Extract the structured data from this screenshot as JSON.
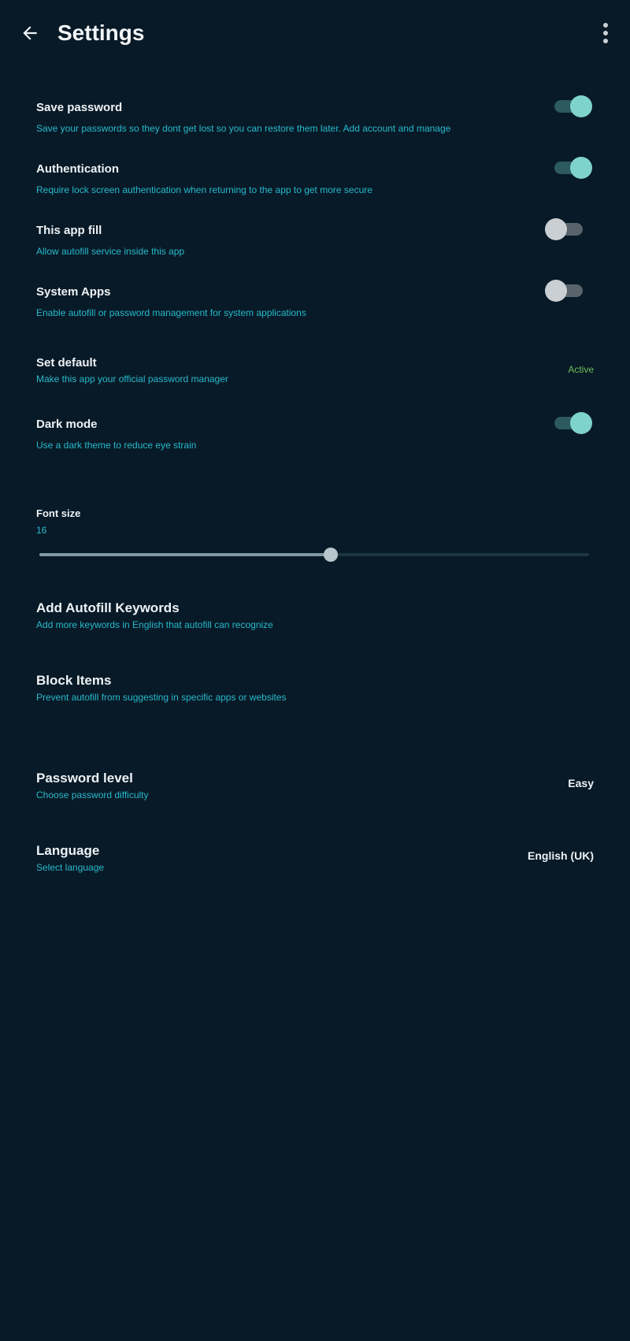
{
  "appbar": {
    "title": "Settings",
    "back_icon": "arrow-back-icon",
    "menu_icon": "more-vert-icon"
  },
  "colors": {
    "background": "#081a27",
    "accent": "#27b9cc",
    "switch_on": "#7fd3cd",
    "status_green": "#6dbf57"
  },
  "settings": {
    "save_password": {
      "title": "Save password",
      "subtitle": "Save your passwords so they dont get lost so you can restore them later. Add account and manage",
      "enabled": true
    },
    "authentication": {
      "title": "Authentication",
      "subtitle": "Require lock screen authentication when returning to the app to get more secure",
      "enabled": true
    },
    "this_app_fill": {
      "title": "This app fill",
      "subtitle": "Allow autofill service inside this app",
      "enabled": false
    },
    "system_apps": {
      "title": "System Apps",
      "subtitle": "Enable autofill or password management for system applications",
      "enabled": false
    },
    "set_default": {
      "title": "Set default",
      "subtitle": "Make this app your official password manager",
      "status": "Active"
    },
    "dark_mode": {
      "title": "Dark mode",
      "subtitle": "Use a dark theme to reduce eye strain",
      "enabled": true
    },
    "font_size": {
      "title": "Font size",
      "value": "16",
      "slider_fraction": 0.53
    },
    "autofill_keywords": {
      "title": "Add Autofill Keywords",
      "subtitle": "Add more keywords in English that autofill can recognize"
    },
    "block_items": {
      "title": "Block Items",
      "subtitle": "Prevent autofill from suggesting in specific apps or websites"
    },
    "password_level": {
      "title": "Password level",
      "subtitle": "Choose password difficulty",
      "value": "Easy"
    },
    "language": {
      "title": "Language",
      "subtitle": "Select language",
      "value": "English (UK)"
    }
  }
}
